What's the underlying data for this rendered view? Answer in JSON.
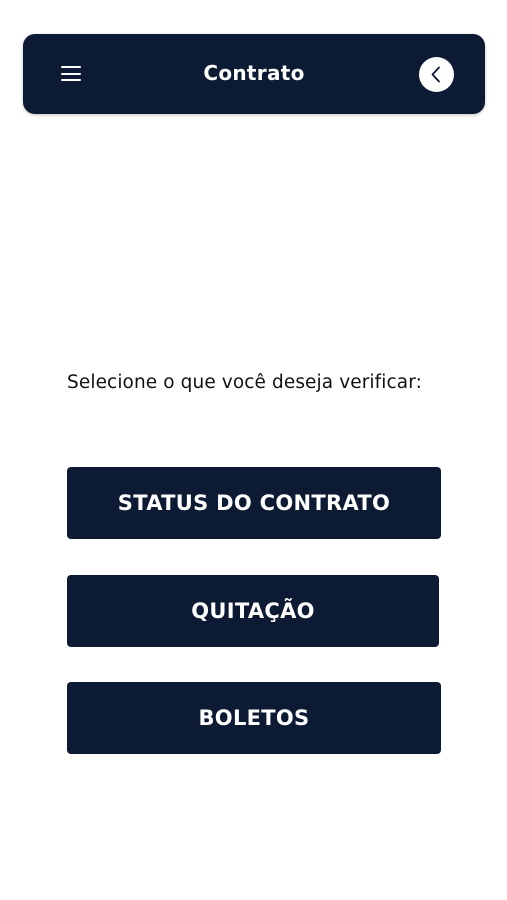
{
  "header": {
    "title": "Contrato",
    "menu_icon": "hamburger-menu-icon",
    "back_icon": "chevron-left-icon"
  },
  "main": {
    "prompt": "Selecione o que você deseja verificar:",
    "buttons": [
      {
        "label": "STATUS DO CONTRATO"
      },
      {
        "label": "QUITAÇÃO"
      },
      {
        "label": "BOLETOS"
      }
    ]
  },
  "colors": {
    "primary": "#0c1a33",
    "background": "#ffffff",
    "text": "#111111"
  }
}
